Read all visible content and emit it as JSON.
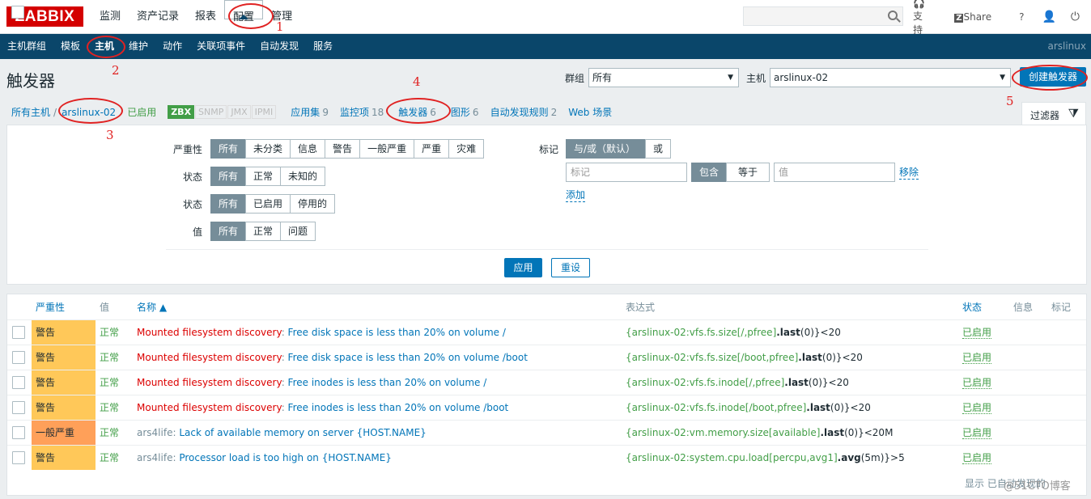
{
  "logo": "ZABBIX",
  "top_menu": [
    "监测",
    "资产记录",
    "报表",
    "配置",
    "管理"
  ],
  "top_links": {
    "support": "支持",
    "share": "Share",
    "help": "?"
  },
  "sub_menu": [
    "主机群组",
    "模板",
    "主机",
    "维护",
    "动作",
    "关联项事件",
    "自动发现",
    "服务"
  ],
  "user": "arslinux",
  "page_title": "触发器",
  "group_label": "群组",
  "group_value": "所有",
  "host_label": "主机",
  "host_value": "arslinux-02",
  "create_button": "创建触发器",
  "hostnav": {
    "all_hosts": "所有主机",
    "host": "arslinux-02",
    "enabled": "已启用",
    "zbx": "ZBX",
    "snmp": "SNMP",
    "jmx": "JMX",
    "ipmi": "IPMI",
    "apps": "应用集",
    "apps_count": "9",
    "items": "监控项",
    "items_count": "18",
    "triggers": "触发器",
    "triggers_count": "6",
    "graphs": "图形",
    "graphs_count": "6",
    "discovery": "自动发现规则",
    "discovery_count": "2",
    "web": "Web 场景"
  },
  "filter_tab": "过滤器",
  "filter": {
    "severity_label": "严重性",
    "severity": [
      "所有",
      "未分类",
      "信息",
      "警告",
      "一般严重",
      "严重",
      "灾难"
    ],
    "state_label": "状态",
    "state": [
      "所有",
      "正常",
      "未知的"
    ],
    "status_label": "状态",
    "status": [
      "所有",
      "已启用",
      "停用的"
    ],
    "value_label": "值",
    "value": [
      "所有",
      "正常",
      "问题"
    ],
    "tags_label": "标记",
    "tag_mode": [
      "与/或（默认）",
      "或"
    ],
    "tag_placeholder": "标记",
    "tag_ops": [
      "包含",
      "等于"
    ],
    "value_placeholder": "值",
    "remove": "移除",
    "add": "添加",
    "apply": "应用",
    "reset": "重设"
  },
  "table": {
    "headers": {
      "severity": "严重性",
      "value": "值",
      "name": "名称 ▲",
      "expression": "表达式",
      "status": "状态",
      "info": "信息",
      "tags": "标记"
    },
    "rows": [
      {
        "severity": "警告",
        "value": "正常",
        "prefix": "Mounted filesystem discovery",
        "name": "Free disk space is less than 20% on volume /",
        "expr_a": "{arslinux-02:vfs.fs.size[/,pfree]",
        "expr_fn": ".last",
        "expr_b": "(0)}<20",
        "status": "已启用"
      },
      {
        "severity": "警告",
        "value": "正常",
        "prefix": "Mounted filesystem discovery",
        "name": "Free disk space is less than 20% on volume /boot",
        "expr_a": "{arslinux-02:vfs.fs.size[/boot,pfree]",
        "expr_fn": ".last",
        "expr_b": "(0)}<20",
        "status": "已启用"
      },
      {
        "severity": "警告",
        "value": "正常",
        "prefix": "Mounted filesystem discovery",
        "name": "Free inodes is less than 20% on volume /",
        "expr_a": "{arslinux-02:vfs.fs.inode[/,pfree]",
        "expr_fn": ".last",
        "expr_b": "(0)}<20",
        "status": "已启用"
      },
      {
        "severity": "警告",
        "value": "正常",
        "prefix": "Mounted filesystem discovery",
        "name": "Free inodes is less than 20% on volume /boot",
        "expr_a": "{arslinux-02:vfs.fs.inode[/boot,pfree]",
        "expr_fn": ".last",
        "expr_b": "(0)}<20",
        "status": "已启用"
      },
      {
        "severity": "一般严重",
        "value": "正常",
        "prefix": "ars4life",
        "name": "Lack of available memory on server {HOST.NAME}",
        "expr_a": "{arslinux-02:vm.memory.size[available]",
        "expr_fn": ".last",
        "expr_b": "(0)}<20M",
        "status": "已启用"
      },
      {
        "severity": "警告",
        "value": "正常",
        "prefix": "ars4life",
        "name": "Processor load is too high on {HOST.NAME}",
        "expr_a": "{arslinux-02:system.cpu.load[percpu,avg1]",
        "expr_fn": ".avg",
        "expr_b": "(5m)}>5",
        "status": "已启用"
      }
    ]
  },
  "footer": "显示 已自动发现的",
  "watermark": "@51CTO博客",
  "annotations": [
    "1",
    "2",
    "3",
    "4",
    "5"
  ],
  "colors": {
    "warning": "#ffc859",
    "average": "#ffa059",
    "nav": "#0a466a",
    "link": "#0275b8",
    "ok": "#429e47"
  }
}
